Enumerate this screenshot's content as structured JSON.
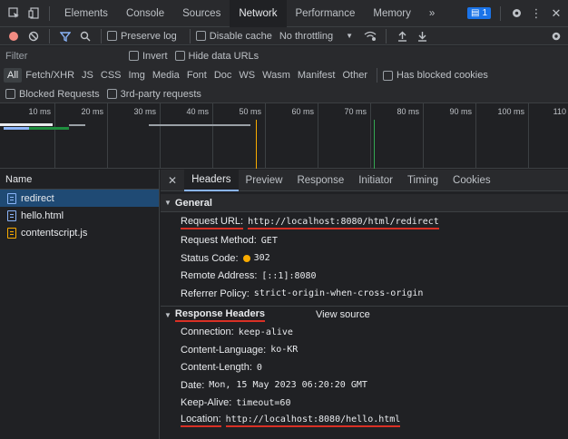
{
  "top_tabs": [
    "Elements",
    "Console",
    "Sources",
    "Network",
    "Performance",
    "Memory"
  ],
  "active_tab": "Network",
  "more_tabs": "»",
  "issues_count": "1",
  "toolbar": {
    "preserve_log": "Preserve log",
    "disable_cache": "Disable cache",
    "throttling": "No throttling"
  },
  "filter": {
    "placeholder": "Filter",
    "invert": "Invert",
    "hide_data_urls": "Hide data URLs"
  },
  "types": [
    "All",
    "Fetch/XHR",
    "JS",
    "CSS",
    "Img",
    "Media",
    "Font",
    "Doc",
    "WS",
    "Wasm",
    "Manifest",
    "Other"
  ],
  "has_blocked_cookies": "Has blocked cookies",
  "blocked_requests": "Blocked Requests",
  "third_party": "3rd-party requests",
  "timeline_ticks": [
    "10 ms",
    "20 ms",
    "30 ms",
    "40 ms",
    "50 ms",
    "60 ms",
    "70 ms",
    "80 ms",
    "90 ms",
    "100 ms",
    "110"
  ],
  "name_header": "Name",
  "requests": [
    {
      "name": "redirect",
      "type": "doc",
      "selected": true
    },
    {
      "name": "hello.html",
      "type": "doc",
      "selected": false
    },
    {
      "name": "contentscript.js",
      "type": "js",
      "selected": false
    }
  ],
  "detail_tabs": [
    "Headers",
    "Preview",
    "Response",
    "Initiator",
    "Timing",
    "Cookies"
  ],
  "active_detail_tab": "Headers",
  "general": {
    "title": "General",
    "request_url_label": "Request URL:",
    "request_url": "http://localhost:8080/html/redirect",
    "method_label": "Request Method:",
    "method": "GET",
    "status_label": "Status Code:",
    "status": "302",
    "remote_label": "Remote Address:",
    "remote": "[::1]:8080",
    "referrer_label": "Referrer Policy:",
    "referrer": "strict-origin-when-cross-origin"
  },
  "response_headers": {
    "title": "Response Headers",
    "view_source": "View source",
    "items": [
      {
        "k": "Connection:",
        "v": "keep-alive"
      },
      {
        "k": "Content-Language:",
        "v": "ko-KR"
      },
      {
        "k": "Content-Length:",
        "v": "0"
      },
      {
        "k": "Date:",
        "v": "Mon, 15 May 2023 06:20:20 GMT"
      },
      {
        "k": "Keep-Alive:",
        "v": "timeout=60"
      },
      {
        "k": "Location:",
        "v": "http://localhost:8080/hello.html"
      }
    ]
  },
  "colors": {
    "accent": "#8ab4f8",
    "underline": "#d93025",
    "status_dot": "#f9ab00"
  }
}
